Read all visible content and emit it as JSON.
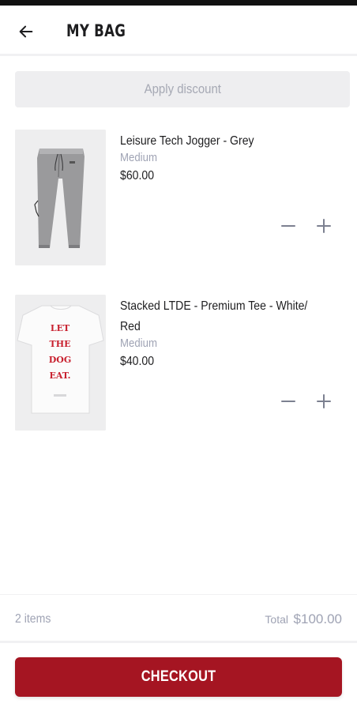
{
  "header": {
    "title": "MY BAG",
    "back_icon": "arrow-left-icon"
  },
  "discount": {
    "label": "Apply discount"
  },
  "items": [
    {
      "name": "Leisure Tech Jogger - Grey",
      "size": "Medium",
      "price": "$60.00",
      "image": "grey-jogger-pants"
    },
    {
      "name": "Stacked LTDE - Premium Tee - White/ Red",
      "size": "Medium",
      "price": "$40.00",
      "image": "white-tee-red-print",
      "print_text": [
        "LET",
        "THE",
        "DOG",
        "EAT."
      ]
    }
  ],
  "summary": {
    "count": "2 items",
    "total_label": "Total",
    "total_value": "$100.00"
  },
  "checkout": {
    "label": "CHECKOUT"
  },
  "colors": {
    "accent": "#a51522",
    "muted": "#9fa3b4",
    "text": "#1d1d1f",
    "surface": "#eeeef0"
  }
}
